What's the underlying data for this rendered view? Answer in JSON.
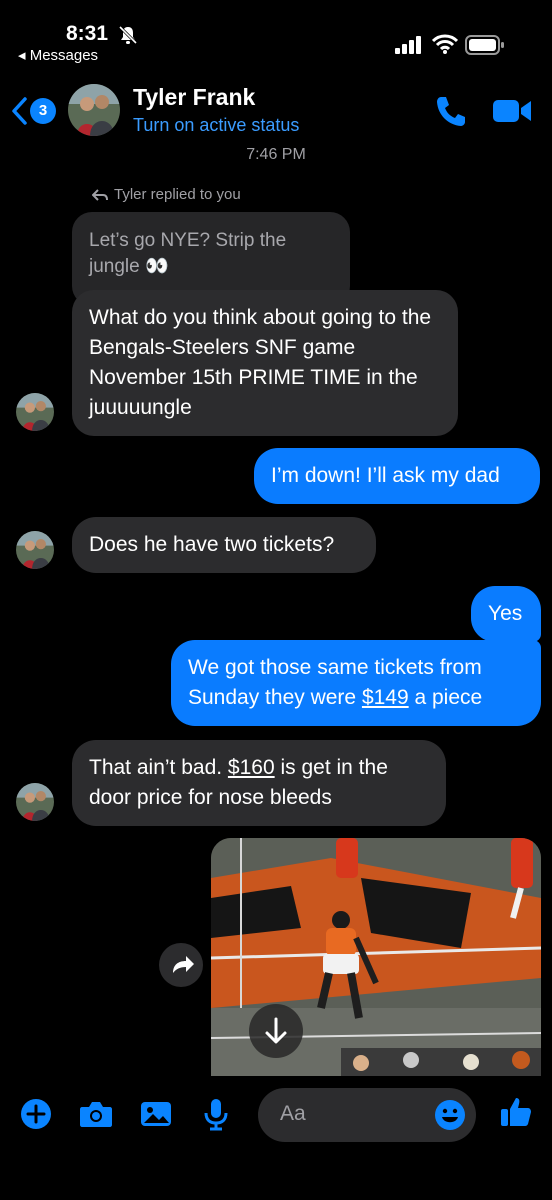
{
  "status_bar": {
    "time": "8:31",
    "back_app_label": "◂ Messages"
  },
  "header": {
    "unread_count": "3",
    "contact_name": "Tyler Frank",
    "status_text": "Turn on active status"
  },
  "conversation": {
    "timestamp": "7:46 PM",
    "reply_note": "Tyler replied to you",
    "quoted_message": "Let’s go NYE? Strip the jungle 👀",
    "messages": [
      {
        "from": "them",
        "text": "What do you think about going to the Bengals-Steelers SNF game November 15th PRIME TIME in the juuuuungle"
      },
      {
        "from": "me",
        "text": "I’m down! I’ll ask my dad"
      },
      {
        "from": "them",
        "text": "Does he have two tickets?"
      },
      {
        "from": "me",
        "text": "Yes"
      },
      {
        "from": "me",
        "text_before": "We got those same tickets from Sunday they were ",
        "link": "$149",
        "text_after": " a piece"
      },
      {
        "from": "them",
        "text_before": "That ain’t bad. ",
        "link": "$160",
        "text_after": " is get in the door price for nose bleeds"
      }
    ],
    "media_alt_icons": [
      "share-icon",
      "download-icon"
    ]
  },
  "composer": {
    "placeholder": "Aa",
    "icons": [
      "plus-icon",
      "camera-icon",
      "image-icon",
      "microphone-icon",
      "emoji-icon",
      "thumbs-up-icon"
    ]
  },
  "colors": {
    "accent": "#0a84ff",
    "outgoing_bubble": "#0a7cff",
    "incoming_bubble": "#2c2c2e",
    "background": "#000000"
  }
}
